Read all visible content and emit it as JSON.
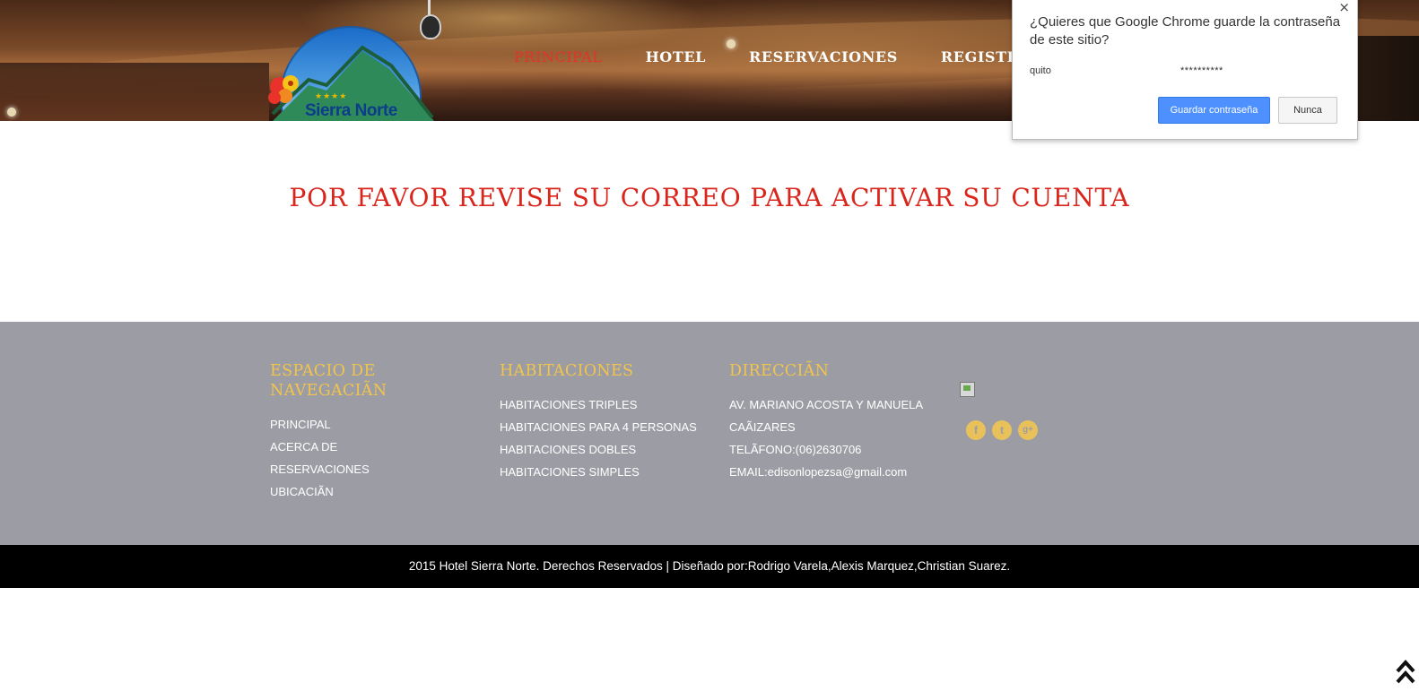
{
  "header": {
    "logo_brand": "Sierra Norte",
    "logo_stars": "★★★★"
  },
  "nav": {
    "items": [
      {
        "label": "PRINCIPAL",
        "active": true
      },
      {
        "label": "HOTEL",
        "active": false
      },
      {
        "label": "RESERVACIONES",
        "active": false
      },
      {
        "label": "REGISTRO",
        "active": false
      }
    ]
  },
  "password_popup": {
    "question": "¿Quieres que Google Chrome guarde la contraseña de este sitio?",
    "username": "quito",
    "password_mask": "**********",
    "save_label": "Guardar contraseña",
    "never_label": "Nunca",
    "close_label": "×"
  },
  "main": {
    "message": "POR FAVOR REVISE SU CORREO PARA ACTIVAR SU CUENTA"
  },
  "footer": {
    "col1": {
      "title": "ESPACIO DE NAVEGACIÃN",
      "links": [
        "PRINCIPAL",
        "ACERCA DE",
        "RESERVACIONES",
        "UBICACIÃN"
      ]
    },
    "col2": {
      "title": "HABITACIONES",
      "links": [
        "HABITACIONES TRIPLES",
        "HABITACIONES PARA 4 PERSONAS",
        "HABITACIONES DOBLES",
        "HABITACIONES SIMPLES"
      ]
    },
    "col3": {
      "title": "DIRECCIÃN",
      "lines": [
        "AV. MARIANO ACOSTA Y MANUELA",
        "CAÃIZARES",
        "TELÃFONO:(06)2630706",
        "EMAIL:edisonlopezsa@gmail.com"
      ]
    },
    "social": [
      {
        "icon": "facebook-icon",
        "glyph": "f"
      },
      {
        "icon": "twitter-icon",
        "glyph": "t"
      },
      {
        "icon": "google-plus-icon",
        "glyph": "g+"
      }
    ]
  },
  "copyright": "2015 Hotel Sierra Norte. Derechos Reservados | Diseñado por:Rodrigo Varela,Alexis Marquez,Christian Suarez.",
  "colors": {
    "accent_red": "#d9251c",
    "footer_bg": "#9c9da4",
    "footer_heading": "#f1c44d",
    "chrome_button": "#4d90fe"
  }
}
